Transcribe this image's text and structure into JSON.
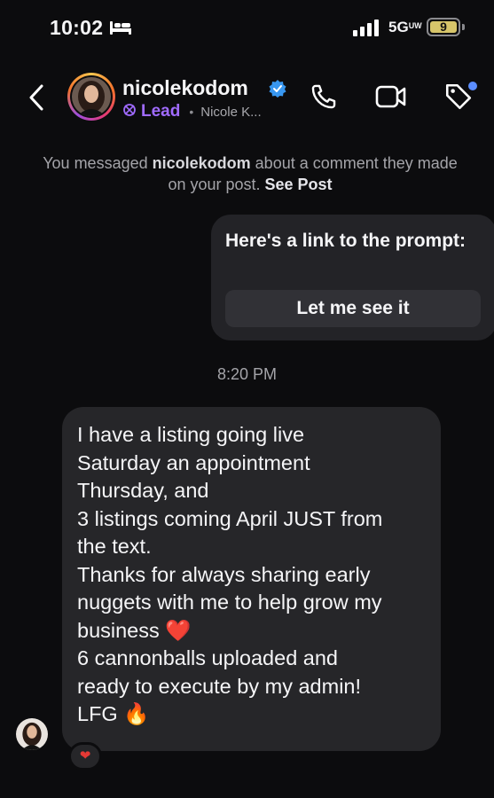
{
  "status_bar": {
    "time": "10:02",
    "network": "5G",
    "network_sup": "UW",
    "battery": "9",
    "battery_color": "#d7c56a"
  },
  "header": {
    "username": "nicolekodom",
    "label": "Lead",
    "subname": "Nicole K...",
    "label_color": "#a06bff",
    "verified_color": "#3897f0",
    "icons": [
      "back-icon",
      "verified-icon",
      "lead-icon",
      "call-icon",
      "video-icon",
      "tag-icon"
    ]
  },
  "notice": {
    "prefix": "You messaged",
    "username": "nicolekodom",
    "middle": "about a comment they made on your post.",
    "link": "See Post"
  },
  "outgoing": {
    "text": "Here's a link to the prompt:",
    "button": "Let me see it"
  },
  "timestamp": "8:20 PM",
  "incoming": {
    "text": "I have a listing going live\nSaturday an appointment\nThursday, and\n3 listings coming April JUST from\nthe text.\nThanks for always sharing early\nnuggets with me to help grow my\nbusiness ❤️\n6 cannonballs uploaded and\nready to execute by my admin!\nLFG 🔥",
    "reaction": "❤"
  }
}
